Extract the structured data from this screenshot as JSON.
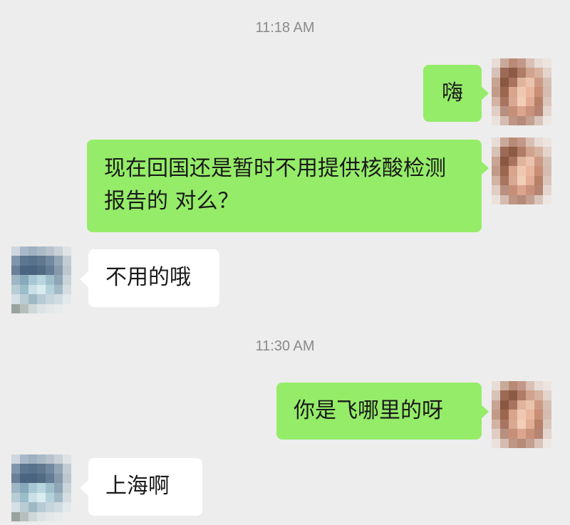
{
  "chat": {
    "timestamps": [
      "11:18 AM",
      "11:30 AM"
    ],
    "messages": [
      {
        "sender": "me",
        "text": "嗨"
      },
      {
        "sender": "me",
        "text": "现在回国还是暂时不用提供核酸检测报告的 对么？"
      },
      {
        "sender": "contact",
        "text": "不用的哦"
      },
      {
        "sender": "me",
        "text": "你是飞哪里的呀"
      },
      {
        "sender": "contact",
        "text": "上海啊"
      }
    ]
  },
  "colors": {
    "background": "#ededed",
    "outgoing_bubble": "#95ec69",
    "incoming_bubble": "#ffffff",
    "timestamp_text": "#8a8a8a",
    "message_text": "#191919"
  },
  "icons": {
    "self_avatar": "pixelated-face-avatar",
    "contact_avatar": "pixelated-landscape-avatar"
  }
}
